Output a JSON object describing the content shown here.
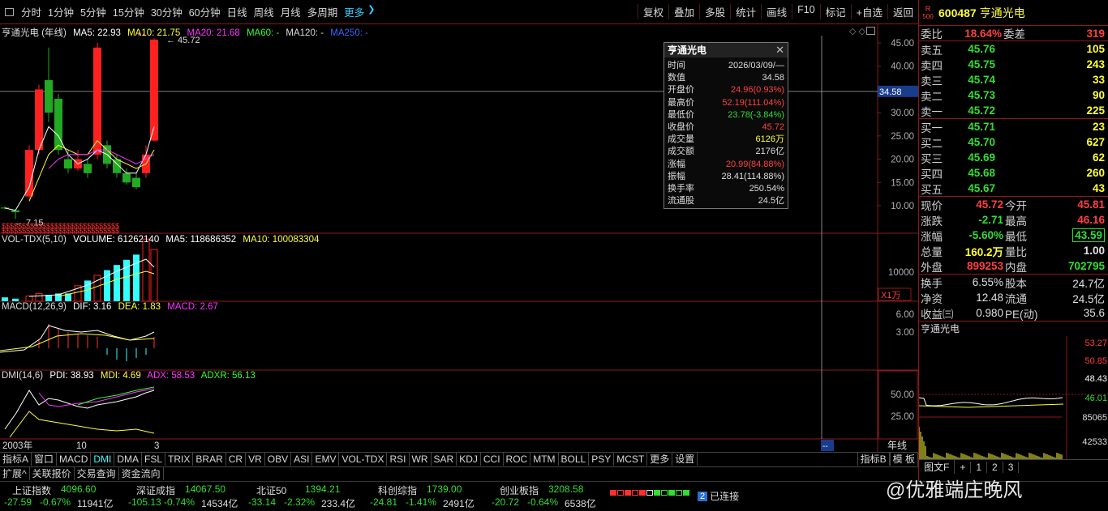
{
  "toolbar": {
    "left": [
      "分时",
      "1分钟",
      "5分钟",
      "15分钟",
      "30分钟",
      "60分钟",
      "日线",
      "周线",
      "月线",
      "多周期",
      "更多"
    ],
    "right": [
      "复权",
      "叠加",
      "多股",
      "统计",
      "画线",
      "F10",
      "标记",
      "+自选",
      "返回"
    ]
  },
  "main": {
    "legend": {
      "name": "亨通光电 (年线)",
      "ma5": "MA5: 22.93",
      "ma10": "MA10: 21.75",
      "ma20": "MA20: 21.68",
      "ma60": "MA60: -",
      "ma120": "MA120: -",
      "ma250": "MA250: -"
    },
    "high_label": "45.72",
    "low_label": "7.15",
    "cursor_price": "34.58",
    "yticks": [
      "45.00",
      "40.00",
      "35.00",
      "30.00",
      "25.00",
      "20.00",
      "15.00",
      "10.00"
    ],
    "s_marks": "$$$$$$$$$$$$$$$$$$$$$$$$$$$$$"
  },
  "vol": {
    "legend": {
      "name": "VOL-TDX(5,10)",
      "volume": "VOLUME: 61262140",
      "ma5": "MA5: 118686352",
      "ma10": "MA10: 100083304"
    },
    "ytick": "10000",
    "unit": "X1万"
  },
  "macd": {
    "legend": {
      "name": "MACD(12,26,9)",
      "dif": "DIF: 3.16",
      "dea": "DEA: 1.83",
      "macd": "MACD: 2.67"
    },
    "yticks": [
      "6.00",
      "3.00"
    ]
  },
  "dmi": {
    "legend": {
      "name": "DMI(14,6)",
      "pdi": "PDI: 38.93",
      "mdi": "MDI: 4.69",
      "adx": "ADX: 58.53",
      "adxr": "ADXR: 56.13"
    },
    "yticks": [
      "50.00",
      "25.00"
    ]
  },
  "xaxis": {
    "labels": [
      "2003年",
      "10",
      "3"
    ],
    "right": "年线",
    "ellipsis": "--"
  },
  "popup": {
    "title": "亨通光电",
    "rows": [
      {
        "k": "时间",
        "v": "2026/03/09/—",
        "c": "#dddddd"
      },
      {
        "k": "数值",
        "v": "34.58",
        "c": "#dddddd"
      },
      {
        "k": "开盘价",
        "v": "24.96(0.93%)",
        "c": "#ff4040"
      },
      {
        "k": "最高价",
        "v": "52.19(111.04%)",
        "c": "#ff4040"
      },
      {
        "k": "最低价",
        "v": "23.78(-3.84%)",
        "c": "#33dd33"
      },
      {
        "k": "收盘价",
        "v": "45.72",
        "c": "#ff4040"
      },
      {
        "k": "成交量",
        "v": "6126万",
        "c": "#ffff33"
      },
      {
        "k": "成交额",
        "v": "2176亿",
        "c": "#dddddd"
      },
      {
        "k": "涨幅",
        "v": "20.99(84.88%)",
        "c": "#ff4040"
      },
      {
        "k": "振幅",
        "v": "28.41(114.88%)",
        "c": "#dddddd"
      },
      {
        "k": "换手率",
        "v": "250.54%",
        "c": "#dddddd"
      },
      {
        "k": "流通股",
        "v": "24.5亿",
        "c": "#dddddd"
      }
    ]
  },
  "tabs": [
    "指标A",
    "窗口",
    "MACD",
    "DMI",
    "DMA",
    "FSL",
    "TRIX",
    "BRAR",
    "CR",
    "VR",
    "OBV",
    "ASI",
    "EMV",
    "VOL-TDX",
    "RSI",
    "WR",
    "SAR",
    "KDJ",
    "CCI",
    "ROC",
    "MTM",
    "BOLL",
    "PSY",
    "MCST",
    "更多",
    "设置"
  ],
  "tabs_right": [
    "指标B",
    "模 板"
  ],
  "tabs2": [
    "扩展^",
    "关联报价",
    "交易查询",
    "资金流向"
  ],
  "quote": {
    "badge_top": "R",
    "badge_bot": "500",
    "code": "600487",
    "name": "亨通光电",
    "weibi": {
      "l": "委比",
      "v": "18.64%",
      "l2": "委差",
      "n": "319"
    },
    "sells": [
      {
        "l": "卖五",
        "p": "45.76",
        "n": "105"
      },
      {
        "l": "卖四",
        "p": "45.75",
        "n": "243"
      },
      {
        "l": "卖三",
        "p": "45.74",
        "n": "33"
      },
      {
        "l": "卖二",
        "p": "45.73",
        "n": "90"
      },
      {
        "l": "卖一",
        "p": "45.72",
        "n": "225"
      }
    ],
    "buys": [
      {
        "l": "买一",
        "p": "45.71",
        "n": "23"
      },
      {
        "l": "买二",
        "p": "45.70",
        "n": "627"
      },
      {
        "l": "买三",
        "p": "45.69",
        "n": "62"
      },
      {
        "l": "买四",
        "p": "45.68",
        "n": "260"
      },
      {
        "l": "买五",
        "p": "45.67",
        "n": "43"
      }
    ],
    "stats": [
      {
        "l": "现价",
        "v": "45.72",
        "vc": "red",
        "l2": "今开",
        "n": "45.81",
        "nc": "red"
      },
      {
        "l": "涨跌",
        "v": "-2.71",
        "vc": "grn",
        "l2": "最高",
        "n": "46.16",
        "nc": "red"
      },
      {
        "l": "涨幅",
        "v": "-5.60%",
        "vc": "grn",
        "l2": "最低",
        "n": "43.59",
        "nc": "grnbox"
      },
      {
        "l": "总量",
        "v": "160.2万",
        "vc": "yel",
        "l2": "量比",
        "n": "1.00",
        "nc": "wht"
      },
      {
        "l": "外盘",
        "v": "899253",
        "vc": "red",
        "l2": "内盘",
        "n": "702795",
        "nc": "grn"
      }
    ],
    "stats2": [
      {
        "l": "换手",
        "v": "6.55%",
        "l2": "股本",
        "n": "24.7亿"
      },
      {
        "l": "净资",
        "v": "12.48",
        "l2": "流通",
        "n": "24.5亿"
      },
      {
        "l": "收益㈢",
        "v": "0.980",
        "l2": "PE(动)",
        "n": "35.6"
      }
    ],
    "mini_title": "亨通光电",
    "mini_right": [
      "53.27",
      "50.85",
      "48.43",
      "46.01",
      "85065",
      "42533"
    ],
    "bottom_tabs": [
      "图文F",
      "+",
      "1",
      "2",
      "3"
    ]
  },
  "status": {
    "indices": [
      {
        "name": "上证指数",
        "val": "4096.60",
        "chg": "-27.59",
        "pct": "-0.67%",
        "amt": "11941亿"
      },
      {
        "name": "深证成指",
        "val": "14067.50",
        "chg": "-105.13",
        "pct": "-0.74%",
        "amt": "14534亿"
      },
      {
        "name": "北证50",
        "val": "1394.21",
        "chg": "-33.14",
        "pct": "-2.32%",
        "amt": "233.4亿"
      },
      {
        "name": "科创综指",
        "val": "1739.00",
        "chg": "-24.81",
        "pct": "-1.41%",
        "amt": "2491亿"
      },
      {
        "name": "创业板指",
        "val": "3208.58",
        "chg": "-20.72",
        "pct": "-0.64%",
        "amt": "6538亿"
      }
    ],
    "conn_num": "2",
    "conn": "已连接",
    "watermark": "@优雅端庄晚风"
  }
}
